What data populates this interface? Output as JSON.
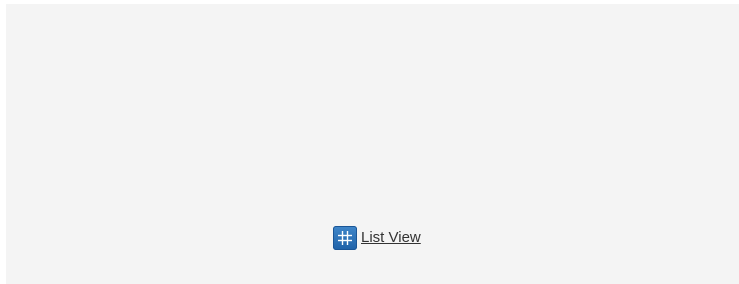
{
  "list_view": {
    "label": "List View",
    "icon": "grid-icon",
    "icon_color": "#2a6fb6"
  },
  "panel": {
    "background": "#f4f4f4"
  }
}
